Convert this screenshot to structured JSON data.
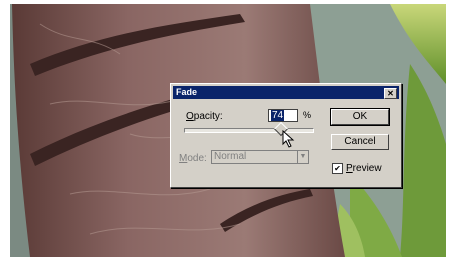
{
  "dialog": {
    "title": "Fade",
    "close_glyph": "✕",
    "opacity_label_prefix": "O",
    "opacity_label_rest": "pacity:",
    "opacity_value": "74",
    "opacity_unit": "%",
    "opacity_level_percent": 74,
    "mode_label_prefix": "M",
    "mode_label_rest": "ode:",
    "mode_value": "Normal",
    "ok_label": "OK",
    "cancel_label": "Cancel",
    "preview_prefix": "P",
    "preview_rest": "review",
    "preview_checked": true,
    "check_glyph": "✔"
  },
  "icons": {
    "close": "close-icon",
    "dropdown": "chevron-down-icon",
    "cursor": "pointer-cursor-icon",
    "slider": "slider-thumb"
  },
  "colors": {
    "titlebar": "#0a246a",
    "dialog_face": "#d4d0c8"
  }
}
